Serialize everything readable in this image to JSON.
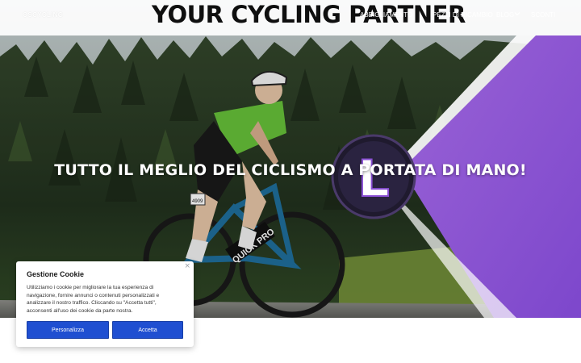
{
  "header": {
    "logo": "OSCYCLING",
    "headline": "YOUR CYCLING PARTNER",
    "nav": [
      {
        "label": "ABBIGLIAMENTO"
      },
      {
        "label": "PEZZI DI RICAMBIO"
      },
      {
        "label": "BLOG"
      },
      {
        "label": "SCONTI"
      }
    ],
    "blog_dropdown_icon": "chevron-down-icon"
  },
  "hero": {
    "title": "TUTTO IL MEGLIO DEL CICLISMO A PORTATA DI MANO!",
    "badge_letter": "L",
    "race_number": "4909",
    "bike_brand": "QUICK PRO"
  },
  "cookie": {
    "title": "Gestione Cookie",
    "lines": [
      "Utilizziamo i cookie per migliorare la tua esperienza di",
      "navigazione, fornire annunci o contenuti personalizzati e",
      "analizzare il nostro traffico. Cliccando su \"Accetta tutti\",",
      "acconsenti all'uso dei cookie da parte nostra."
    ],
    "customize_label": "Personalizza",
    "accept_label": "Accetta",
    "close_glyph": "×"
  },
  "colors": {
    "accent_blue": "#1f4fd1",
    "purple": "#8a4fd4",
    "headline_text": "#0f0f0f"
  }
}
